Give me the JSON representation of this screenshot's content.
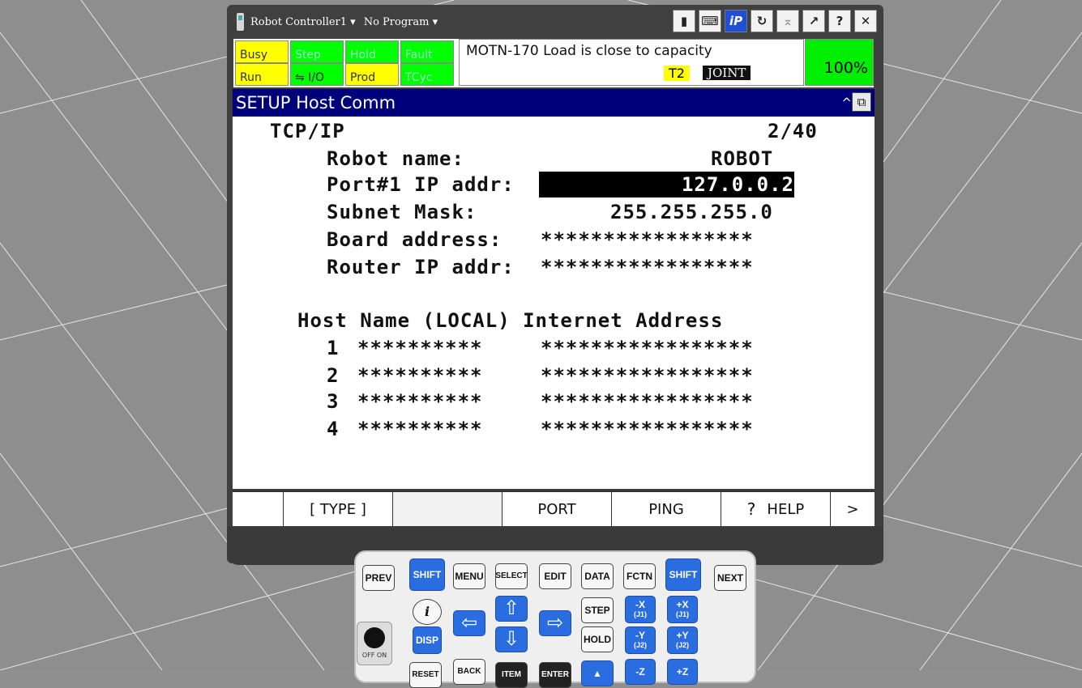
{
  "titlebar": {
    "controller": "Robot Controller1",
    "program": "No Program"
  },
  "status": {
    "busy": "Busy",
    "step": "Step",
    "hold": "Hold",
    "fault": "Fault",
    "run": "Run",
    "io": "I/O",
    "prod": "Prod",
    "tcyc": "TCyc"
  },
  "message": {
    "alarm": "MOTN-170 Load is close to capacity",
    "mode": "T2",
    "coord": "JOINT",
    "override": "100%"
  },
  "screen": {
    "title": "SETUP Host Comm",
    "section": "TCP/IP",
    "page": "2/40",
    "robot_name_label": "Robot name:",
    "robot_name": "ROBOT",
    "port1_label": "Port#1 IP addr:",
    "port1_ip": "127.0.0.2",
    "subnet_label": "Subnet Mask:",
    "subnet": "255.255.255.0",
    "board_label": "Board address:",
    "board": "*****************",
    "router_label": "Router IP addr:",
    "router": "*****************",
    "hosts_header": "Host Name (LOCAL) Internet Address",
    "hosts": [
      {
        "num": "1",
        "name": "**********",
        "addr": "*****************"
      },
      {
        "num": "2",
        "name": "**********",
        "addr": "*****************"
      },
      {
        "num": "3",
        "name": "**********",
        "addr": "*****************"
      },
      {
        "num": "4",
        "name": "**********",
        "addr": "*****************"
      }
    ]
  },
  "fkeys": {
    "f1": "[ TYPE ]",
    "f2": "",
    "f3": "PORT",
    "f4": "PING",
    "f5": "HELP",
    "next": ">"
  },
  "keypad": {
    "prev": "PREV",
    "shift": "SHIFT",
    "menu": "MENU",
    "select": "SELECT",
    "edit": "EDIT",
    "data": "DATA",
    "fctn": "FCTN",
    "next": "NEXT",
    "info": "i",
    "disp": "DISP",
    "step": "STEP",
    "hold": "HOLD",
    "xneg": "-X",
    "xpos": "+X",
    "j1": "(J1)",
    "yneg": "-Y",
    "ypos": "+Y",
    "j2": "(J2)",
    "zneg": "-Z",
    "zpos": "+Z",
    "reset": "RESET",
    "back": "BACK",
    "item": "ITEM",
    "enter": "ENTER",
    "off_on": "OFF  ON"
  }
}
